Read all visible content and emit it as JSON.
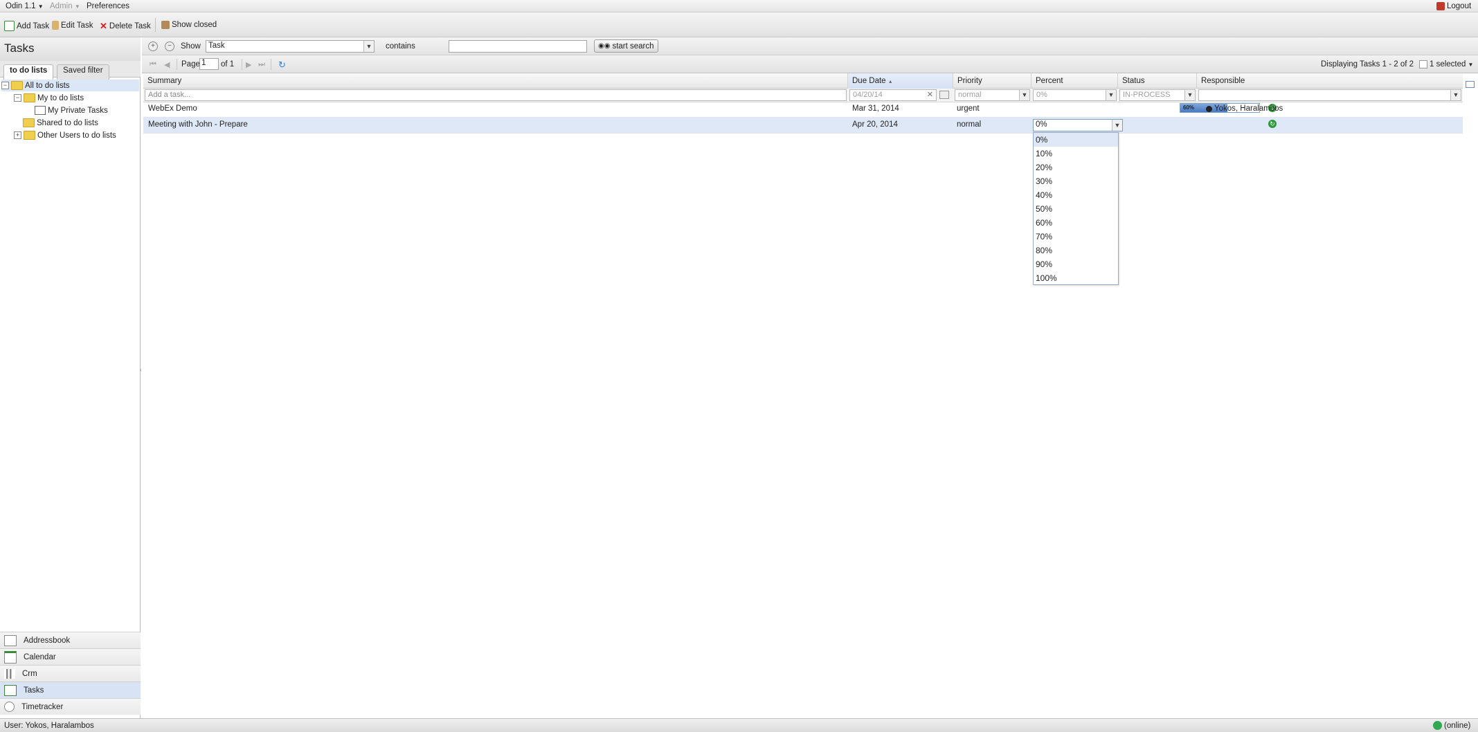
{
  "topmenu": {
    "app": "Odin 1.1",
    "admin": "Admin",
    "preferences": "Preferences",
    "logout": "Logout"
  },
  "toolbar": {
    "add_task": "Add Task",
    "edit_task": "Edit Task",
    "delete_task": "Delete Task",
    "show_closed": "Show closed"
  },
  "left": {
    "title": "Tasks",
    "tabs": [
      "to do lists",
      "Saved filter"
    ],
    "tree": {
      "all": "All to do lists",
      "my": "My to do lists",
      "private": "My Private Tasks",
      "shared": "Shared to do lists",
      "others": "Other Users to do lists"
    },
    "modules": [
      "Addressbook",
      "Calendar",
      "Crm",
      "Tasks",
      "Timetracker"
    ]
  },
  "search": {
    "show_label": "Show",
    "show_value": "Task",
    "op_label": "contains",
    "query": "",
    "button": "start search"
  },
  "paging": {
    "page_label": "Page",
    "page_value": "1",
    "of_label": "of 1",
    "displaying": "Displaying Tasks 1 - 2 of 2",
    "selected": "1 selected"
  },
  "grid": {
    "columns": [
      "Summary",
      "Due Date",
      "Priority",
      "Percent",
      "Status",
      "Responsible"
    ],
    "filter": {
      "summary": "Add a task...",
      "due": "04/20/14",
      "priority": "normal",
      "percent": "0%",
      "status": "IN-PROCESS",
      "responsible": ""
    },
    "rows": [
      {
        "summary": "WebEx Demo",
        "due": "Mar 31, 2014",
        "priority": "urgent",
        "percent": 60,
        "percent_label": "60%",
        "responsible": "Yokos, Haralambos"
      },
      {
        "summary": "Meeting with John - Prepare",
        "due": "Apr 20, 2014",
        "priority": "normal",
        "percent_input": "0%",
        "responsible": ""
      }
    ]
  },
  "percent_options": [
    "0%",
    "10%",
    "20%",
    "30%",
    "40%",
    "50%",
    "60%",
    "70%",
    "80%",
    "90%",
    "100%"
  ],
  "statusbar": {
    "user": "User: Yokos, Haralambos",
    "online": "(online)"
  },
  "colors": {
    "selection": "#dfe8f6",
    "progress": "#4879c0",
    "status_ok": "#2f9a3b"
  }
}
